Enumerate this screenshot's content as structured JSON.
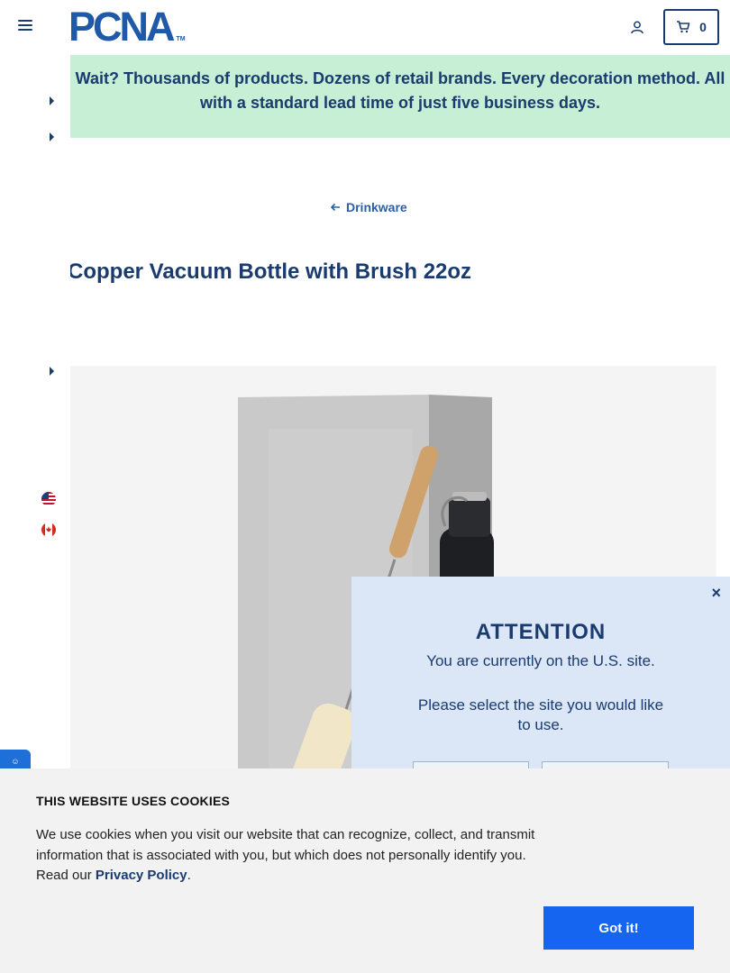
{
  "header": {
    "logo_text": "PCNA",
    "logo_tm": "TM",
    "cart_count": "0"
  },
  "banner": {
    "text": "Wait? Thousands of products. Dozens of retail brands. Every decoration method. All with a standard lead time of just five business days."
  },
  "breadcrumb": {
    "label": "Drinkware"
  },
  "product": {
    "title": "Copper Vacuum Bottle with Brush 22oz"
  },
  "feedback_tab": {
    "label": "☺"
  },
  "site_modal": {
    "heading": "ATTENTION",
    "current_site": "You are currently on the U.S. site.",
    "prompt": "Please select the site you would like to use.",
    "close_label": "×"
  },
  "cookie_banner": {
    "heading": "THIS WEBSITE USES COOKIES",
    "body": "We use cookies when you visit our website that can recognize, collect, and transmit information that is associated with you, but which does not personally identify you. Read our ",
    "link_label": "Privacy Policy",
    "period": ".",
    "button_label": "Got it!"
  },
  "colors": {
    "navy": "#1a3b6e",
    "banner_green": "#c6efd6",
    "modal_blue": "#dbe6f6",
    "button_blue": "#1565f0"
  }
}
